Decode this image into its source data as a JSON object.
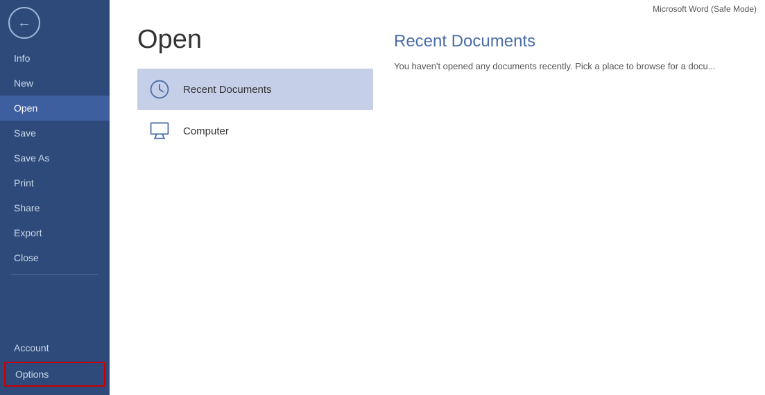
{
  "app": {
    "title": "Microsoft Word (Safe Mode)"
  },
  "sidebar": {
    "back_label": "←",
    "items": [
      {
        "id": "info",
        "label": "Info",
        "active": false
      },
      {
        "id": "new",
        "label": "New",
        "active": false
      },
      {
        "id": "open",
        "label": "Open",
        "active": true
      },
      {
        "id": "save",
        "label": "Save",
        "active": false
      },
      {
        "id": "save-as",
        "label": "Save As",
        "active": false
      },
      {
        "id": "print",
        "label": "Print",
        "active": false
      },
      {
        "id": "share",
        "label": "Share",
        "active": false
      },
      {
        "id": "export",
        "label": "Export",
        "active": false
      },
      {
        "id": "close",
        "label": "Close",
        "active": false
      }
    ],
    "bottom_items": [
      {
        "id": "account",
        "label": "Account"
      },
      {
        "id": "options",
        "label": "Options"
      }
    ]
  },
  "page": {
    "title": "Open"
  },
  "locations": [
    {
      "id": "recent-documents",
      "label": "Recent Documents",
      "active": true
    },
    {
      "id": "computer",
      "label": "Computer",
      "active": false
    }
  ],
  "content": {
    "section_title": "Recent Documents",
    "section_desc": "You haven't opened any documents recently. Pick a place to browse for a docu..."
  }
}
